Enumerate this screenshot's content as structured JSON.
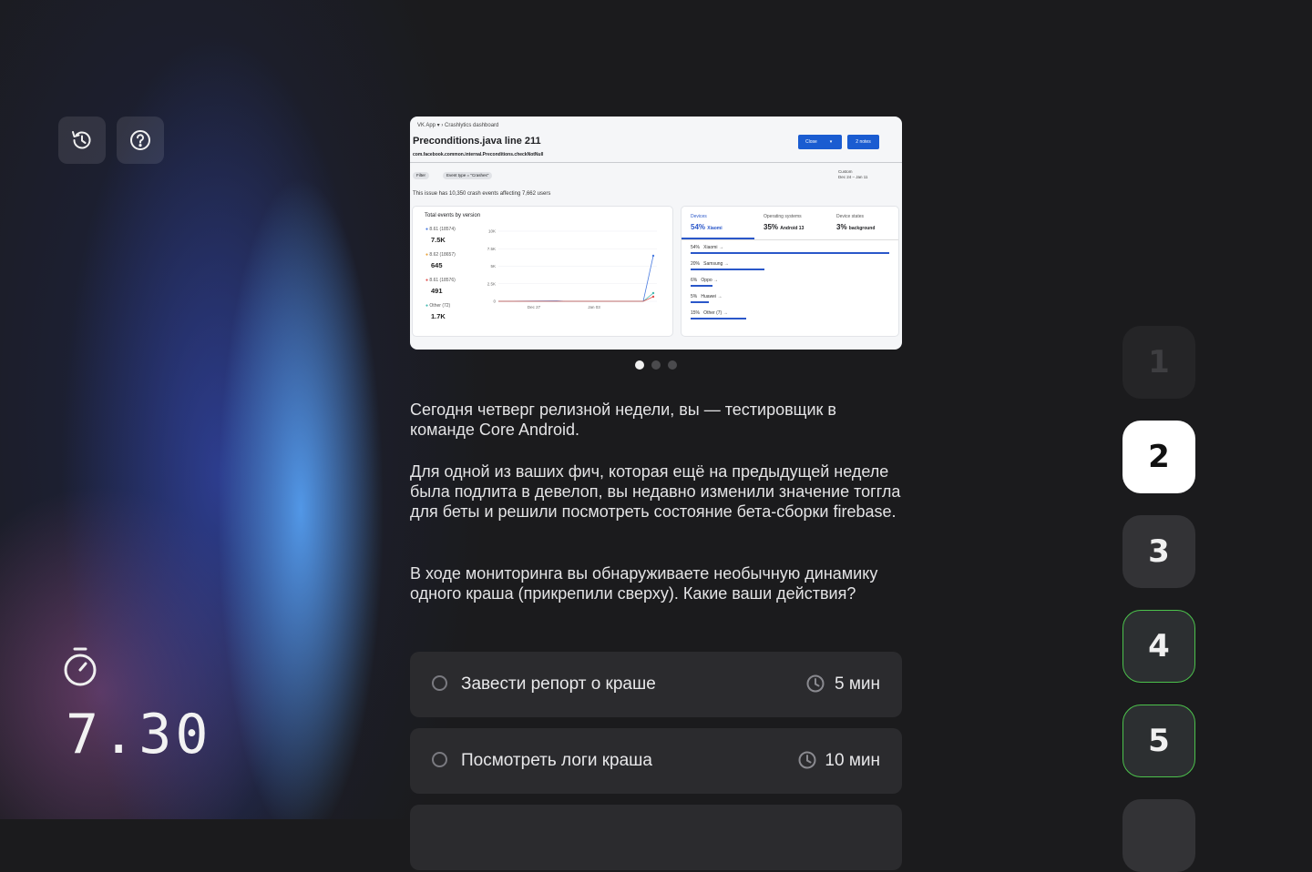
{
  "toolbar": {
    "history_icon": "history-icon",
    "help_icon": "help-icon"
  },
  "timer": {
    "icon": "stopwatch-icon",
    "value": "7.30"
  },
  "screenshot": {
    "breadcrumb_app": "VK App",
    "breadcrumb_page": "Crashlytics dashboard",
    "title": "Preconditions.java line 211",
    "subtitle": "com.facebook.common.internal.Preconditions.checkNotNull",
    "close_button": "Close",
    "notes_button": "2 notes",
    "filter_chip": "Filter",
    "event_chip": "Event type = \"Crashes\"",
    "range_label": "Custom",
    "range_value": "Dec 24 – Jan 11",
    "issue_text": "This issue has 10,350 crash events affecting 7,662 users",
    "events_panel": {
      "title": "Total events by version",
      "legend": [
        {
          "name": "8.61 (18574)",
          "value": "7.5K",
          "color": "#4a7be0"
        },
        {
          "name": "8.62 (18657)",
          "value": "645",
          "color": "#e8a23c"
        },
        {
          "name": "8.61 (18576)",
          "value": "491",
          "color": "#e0514f"
        },
        {
          "name": "Other (72)",
          "value": "1.7K",
          "color": "#43b9b0"
        }
      ],
      "y_ticks": [
        "10K",
        "7.5K",
        "5K",
        "2.5K",
        "0"
      ],
      "x_ticks": [
        "Dec 27",
        "Jan 03"
      ]
    },
    "breakdown_panel": {
      "tabs": [
        {
          "label": "Devices",
          "pct": "54%",
          "detail": "Xiaomi"
        },
        {
          "label": "Operating systems",
          "pct": "35%",
          "detail": "Android 13"
        },
        {
          "label": "Device states",
          "pct": "3%",
          "detail": "background"
        }
      ],
      "rows": [
        {
          "pct": "54%",
          "name": "Xiaomi",
          "share": 0.54
        },
        {
          "pct": "20%",
          "name": "Samsung",
          "share": 0.2
        },
        {
          "pct": "6%",
          "name": "Oppo",
          "share": 0.06
        },
        {
          "pct": "5%",
          "name": "Huawei",
          "share": 0.05
        },
        {
          "pct": "15%",
          "name": "Other (7)",
          "share": 0.15
        }
      ]
    }
  },
  "carousel": {
    "count": 3,
    "active": 1
  },
  "question": {
    "p1": "Сегодня четверг релизной недели, вы — тестировщик в команде Core Android.",
    "p2": "Для одной из ваших фич, которая ещё на предыдущей неделе была подлита в девелоп, вы недавно изменили значение тоггла для беты и решили посмотреть состояние бета-сборки firebase.",
    "p3": "В ходе мониторинга вы обнаруживаете необычную динамику одного краша (прикрепили сверху). Какие ваши действия?"
  },
  "options": [
    {
      "label": "Завести репорт о краше",
      "time": "5 мин"
    },
    {
      "label": "Посмотреть логи краша",
      "time": "10 мин"
    }
  ],
  "steps": [
    "1",
    "2",
    "3",
    "4",
    "5"
  ]
}
